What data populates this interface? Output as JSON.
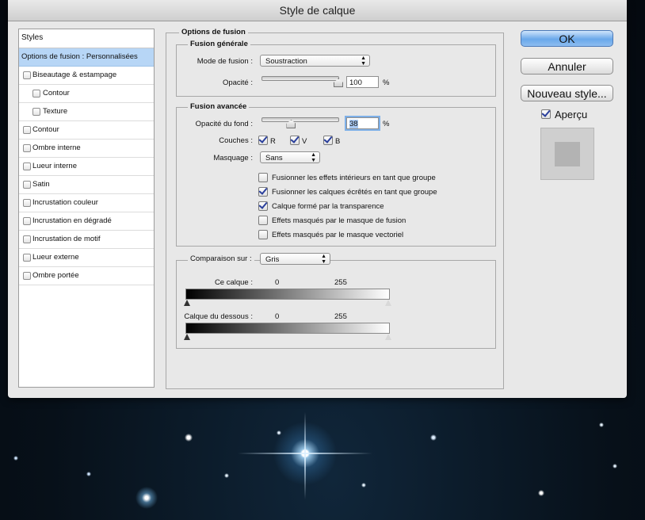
{
  "window": {
    "title": "Style de calque"
  },
  "styles_panel": {
    "header": "Styles",
    "items": [
      {
        "label": "Options de fusion : Personnalisées",
        "selected": true,
        "checkbox": false,
        "sub": false
      },
      {
        "label": "Biseautage & estampage",
        "checkbox": true,
        "checked": false,
        "sub": false
      },
      {
        "label": "Contour",
        "checkbox": true,
        "checked": false,
        "sub": true
      },
      {
        "label": "Texture",
        "checkbox": true,
        "checked": false,
        "sub": true
      },
      {
        "label": "Contour",
        "checkbox": true,
        "checked": false,
        "sub": false
      },
      {
        "label": "Ombre interne",
        "checkbox": true,
        "checked": false,
        "sub": false
      },
      {
        "label": "Lueur interne",
        "checkbox": true,
        "checked": false,
        "sub": false
      },
      {
        "label": "Satin",
        "checkbox": true,
        "checked": false,
        "sub": false
      },
      {
        "label": "Incrustation couleur",
        "checkbox": true,
        "checked": false,
        "sub": false
      },
      {
        "label": "Incrustation en dégradé",
        "checkbox": true,
        "checked": false,
        "sub": false
      },
      {
        "label": "Incrustation de motif",
        "checkbox": true,
        "checked": false,
        "sub": false
      },
      {
        "label": "Lueur externe",
        "checkbox": true,
        "checked": false,
        "sub": false
      },
      {
        "label": "Ombre portée",
        "checkbox": true,
        "checked": false,
        "sub": false
      }
    ]
  },
  "blend_options": {
    "title": "Options de fusion",
    "general": {
      "title": "Fusion générale",
      "mode_label": "Mode de fusion :",
      "mode_value": "Soustraction",
      "opacity_label": "Opacité :",
      "opacity_value": "100",
      "opacity_unit": "%",
      "opacity_fraction": 1.0
    },
    "advanced": {
      "title": "Fusion avancée",
      "fill_opacity_label": "Opacité du fond :",
      "fill_opacity_value": "38",
      "fill_opacity_unit": "%",
      "fill_opacity_fraction": 0.38,
      "channels_label": "Couches :",
      "channels": [
        {
          "label": "R",
          "checked": true
        },
        {
          "label": "V",
          "checked": true
        },
        {
          "label": "B",
          "checked": true
        }
      ],
      "knockout_label": "Masquage :",
      "knockout_value": "Sans",
      "options": [
        {
          "label": "Fusionner les effets intérieurs en tant que groupe",
          "checked": false
        },
        {
          "label": "Fusionner les calques écrêtés en tant que groupe",
          "checked": true
        },
        {
          "label": "Calque formé par la transparence",
          "checked": true
        },
        {
          "label": "Effets masqués par le masque de fusion",
          "checked": false
        },
        {
          "label": "Effets masqués par le masque vectoriel",
          "checked": false
        }
      ]
    },
    "blend_if": {
      "label": "Comparaison sur :",
      "value": "Gris",
      "this_layer_label": "Ce calque :",
      "this_layer_min": "0",
      "this_layer_max": "255",
      "underlying_label": "Calque du dessous :",
      "underlying_min": "0",
      "underlying_max": "255"
    }
  },
  "buttons": {
    "ok": "OK",
    "cancel": "Annuler",
    "new_style": "Nouveau style...",
    "preview_label": "Aperçu",
    "preview_checked": true
  }
}
